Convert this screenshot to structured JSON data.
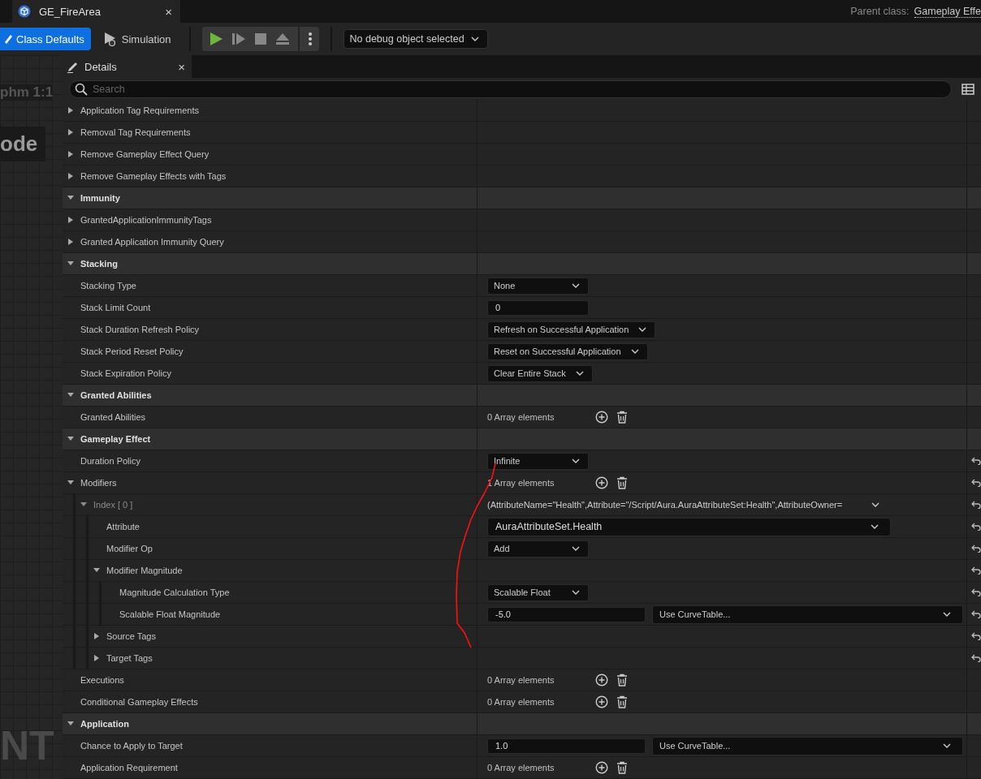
{
  "document_tab": {
    "title": "GE_FireArea",
    "close": "×"
  },
  "parent_class": {
    "label": "Parent class:",
    "value": "Gameplay Effe"
  },
  "toolbar": {
    "modes": [
      {
        "label": "Class Defaults",
        "selected": true
      },
      {
        "label": "Simulation",
        "selected": false
      }
    ],
    "debug_object": "No debug object selected"
  },
  "graph": {
    "labels": [
      "phm 1:1",
      "ode",
      "NT"
    ]
  },
  "details": {
    "tab": "Details",
    "close": "×",
    "search": {
      "placeholder": "Search"
    },
    "rows": [
      {
        "label": "Application Tag Requirements",
        "expanded": false
      },
      {
        "label": "Removal Tag Requirements",
        "expanded": false
      },
      {
        "label": "Remove Gameplay Effect Query",
        "expanded": false
      },
      {
        "label": "Remove Gameplay Effects with Tags",
        "expanded": false
      },
      {
        "kind": "category",
        "label": "Immunity",
        "expanded": true
      },
      {
        "label": "GrantedApplicationImmunityTags",
        "expanded": false
      },
      {
        "label": "Granted Application Immunity Query",
        "expanded": false
      },
      {
        "kind": "category",
        "label": "Stacking",
        "expanded": true
      },
      {
        "label": "Stacking Type",
        "value": {
          "kind": "dropdown",
          "text": "None"
        }
      },
      {
        "label": "Stack Limit Count",
        "value": {
          "kind": "number",
          "text": "0"
        }
      },
      {
        "label": "Stack Duration Refresh Policy",
        "value": {
          "kind": "dropdown",
          "text": "Refresh on Successful Application"
        }
      },
      {
        "label": "Stack Period Reset Policy",
        "value": {
          "kind": "dropdown",
          "text": "Reset on Successful Application"
        }
      },
      {
        "label": "Stack Expiration Policy",
        "value": {
          "kind": "dropdown",
          "text": "Clear Entire Stack"
        }
      },
      {
        "kind": "category",
        "label": "Granted Abilities",
        "expanded": true
      },
      {
        "label": "Granted Abilities",
        "value": {
          "kind": "array",
          "text": "0 Array elements"
        }
      },
      {
        "kind": "category",
        "label": "Gameplay Effect",
        "expanded": true
      },
      {
        "label": "Duration Policy",
        "reset": true,
        "value": {
          "kind": "dropdown",
          "text": "Infinite"
        }
      },
      {
        "label": "Modifiers",
        "expanded": true,
        "reset": true,
        "value": {
          "kind": "array",
          "text": "1 Array elements"
        },
        "children": [
          {
            "kind": "element",
            "label": "Index [ 0 ]",
            "expanded": true,
            "reset": true,
            "value": {
              "kind": "struct",
              "text": "(AttributeName=\"Health\",Attribute=\"/Script/Aura.AuraAttributeSet:Health\",AttributeOwner="
            },
            "children": [
              {
                "label": "Attribute",
                "reset": true,
                "value": {
                  "kind": "picker",
                  "text": "AuraAttributeSet.Health"
                }
              },
              {
                "label": "Modifier Op",
                "reset": true,
                "value": {
                  "kind": "dropdown",
                  "text": "Add"
                }
              },
              {
                "label": "Modifier Magnitude",
                "expanded": true,
                "reset": true,
                "children": [
                  {
                    "label": "Magnitude Calculation Type",
                    "reset": true,
                    "value": {
                      "kind": "dropdown",
                      "text": "Scalable Float"
                    }
                  },
                  {
                    "label": "Scalable Float Magnitude",
                    "reset": true,
                    "value": {
                      "kind": "curve",
                      "text": "-5.0",
                      "curve": "Use CurveTable..."
                    }
                  }
                ]
              },
              {
                "label": "Source Tags",
                "expanded": false,
                "reset": true
              },
              {
                "label": "Target Tags",
                "expanded": false,
                "reset": true
              }
            ]
          }
        ]
      },
      {
        "label": "Executions",
        "value": {
          "kind": "array",
          "text": "0 Array elements"
        }
      },
      {
        "label": "Conditional Gameplay Effects",
        "value": {
          "kind": "array",
          "text": "0 Array elements"
        }
      },
      {
        "kind": "category",
        "label": "Application",
        "expanded": true
      },
      {
        "label": "Chance to Apply to Target",
        "value": {
          "kind": "curve",
          "text": "1.0",
          "curve": "Use CurveTable..."
        }
      },
      {
        "label": "Application Requirement",
        "value": {
          "kind": "array",
          "text": "0 Array elements"
        }
      }
    ]
  }
}
